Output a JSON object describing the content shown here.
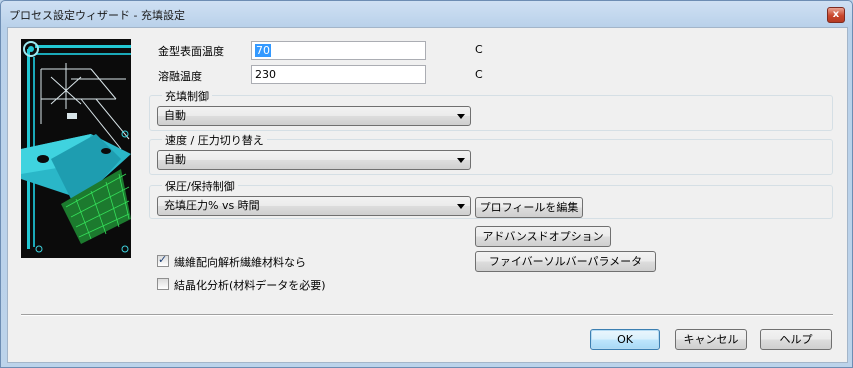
{
  "window": {
    "title": "プロセス設定ウィザード - 充填設定",
    "close_glyph": "x"
  },
  "mold_temp": {
    "label": "金型表面温度",
    "value": "70",
    "unit": "C"
  },
  "melt_temp": {
    "label": "溶融温度",
    "value": "230",
    "unit": "C"
  },
  "fill_control": {
    "title": "充填制御",
    "selected": "自動"
  },
  "vp_switchover": {
    "title": "速度 / 圧力切り替え",
    "selected": "自動"
  },
  "pack_control": {
    "title": "保圧/保持制御",
    "selected": "充填圧力% vs 時間",
    "edit_profile_label": "プロフィールを編集"
  },
  "advanced_options_label": "アドバンスドオプション",
  "fiber_solver_label": "ファイバーソルバーパラメータ",
  "fiber_analysis": {
    "label": "繊維配向解析繊維材料なら",
    "checked": true,
    "check_glyph": "✓"
  },
  "crystallization": {
    "label": "結晶化分析(材料データを必要)",
    "checked": false
  },
  "buttons": {
    "ok": "OK",
    "cancel": "キャンセル",
    "help": "ヘルプ"
  }
}
